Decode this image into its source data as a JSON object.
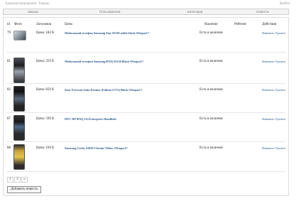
{
  "header": {
    "title": "Администрирование: Товары",
    "logout": "Выйти"
  },
  "menu": [
    "Заказы",
    "Пользователи",
    "Категории",
    "Новости"
  ],
  "table": {
    "columns": [
      "id",
      "Фото",
      "Заголовок",
      "Цена",
      "Наличие",
      "Рейтинг",
      "Действия"
    ],
    "rows": [
      {
        "id": "79",
        "price": "Цена: 184 $",
        "name": "Мобильный телефон Samsung Star S5230 noble black Обзоры!!!",
        "stock": "Есть в наличии",
        "actions": "Изменить  Удалить"
      },
      {
        "id": "81",
        "price": "Цена: 259 $",
        "name": "Мобильный телефон Samsung B7(9) S5230 Black Обзоры!!!",
        "stock": "Есть в наличии",
        "actions": "Изменить  Удалить"
      },
      {
        "id": "82",
        "price": "Цена: 650 $",
        "name": "Sony Ericsson Satio Dreams (Edition G715) Black Обзоры!!!",
        "stock": "Есть в наличии",
        "actions": "Изменить  Удалить"
      },
      {
        "id": "87",
        "price": "Цена: 599 $",
        "name": "HTC HP iPAQ 214 Enterprise Handheld",
        "stock": "Есть в наличии",
        "actions": "Изменить  Удалить"
      },
      {
        "id": "88",
        "price": "Цена: 169 $",
        "name": "Samsung Corby S3650 Chrome Yellow Обзоры!!!",
        "stock": "Есть в наличии",
        "actions": "Изменить  Удалить"
      }
    ]
  },
  "pagination": [
    "1",
    "2",
    "»"
  ],
  "add_button": "Добавить новость",
  "colors": {
    "link": "#2a5a8c",
    "border": "#dcdcdc"
  }
}
